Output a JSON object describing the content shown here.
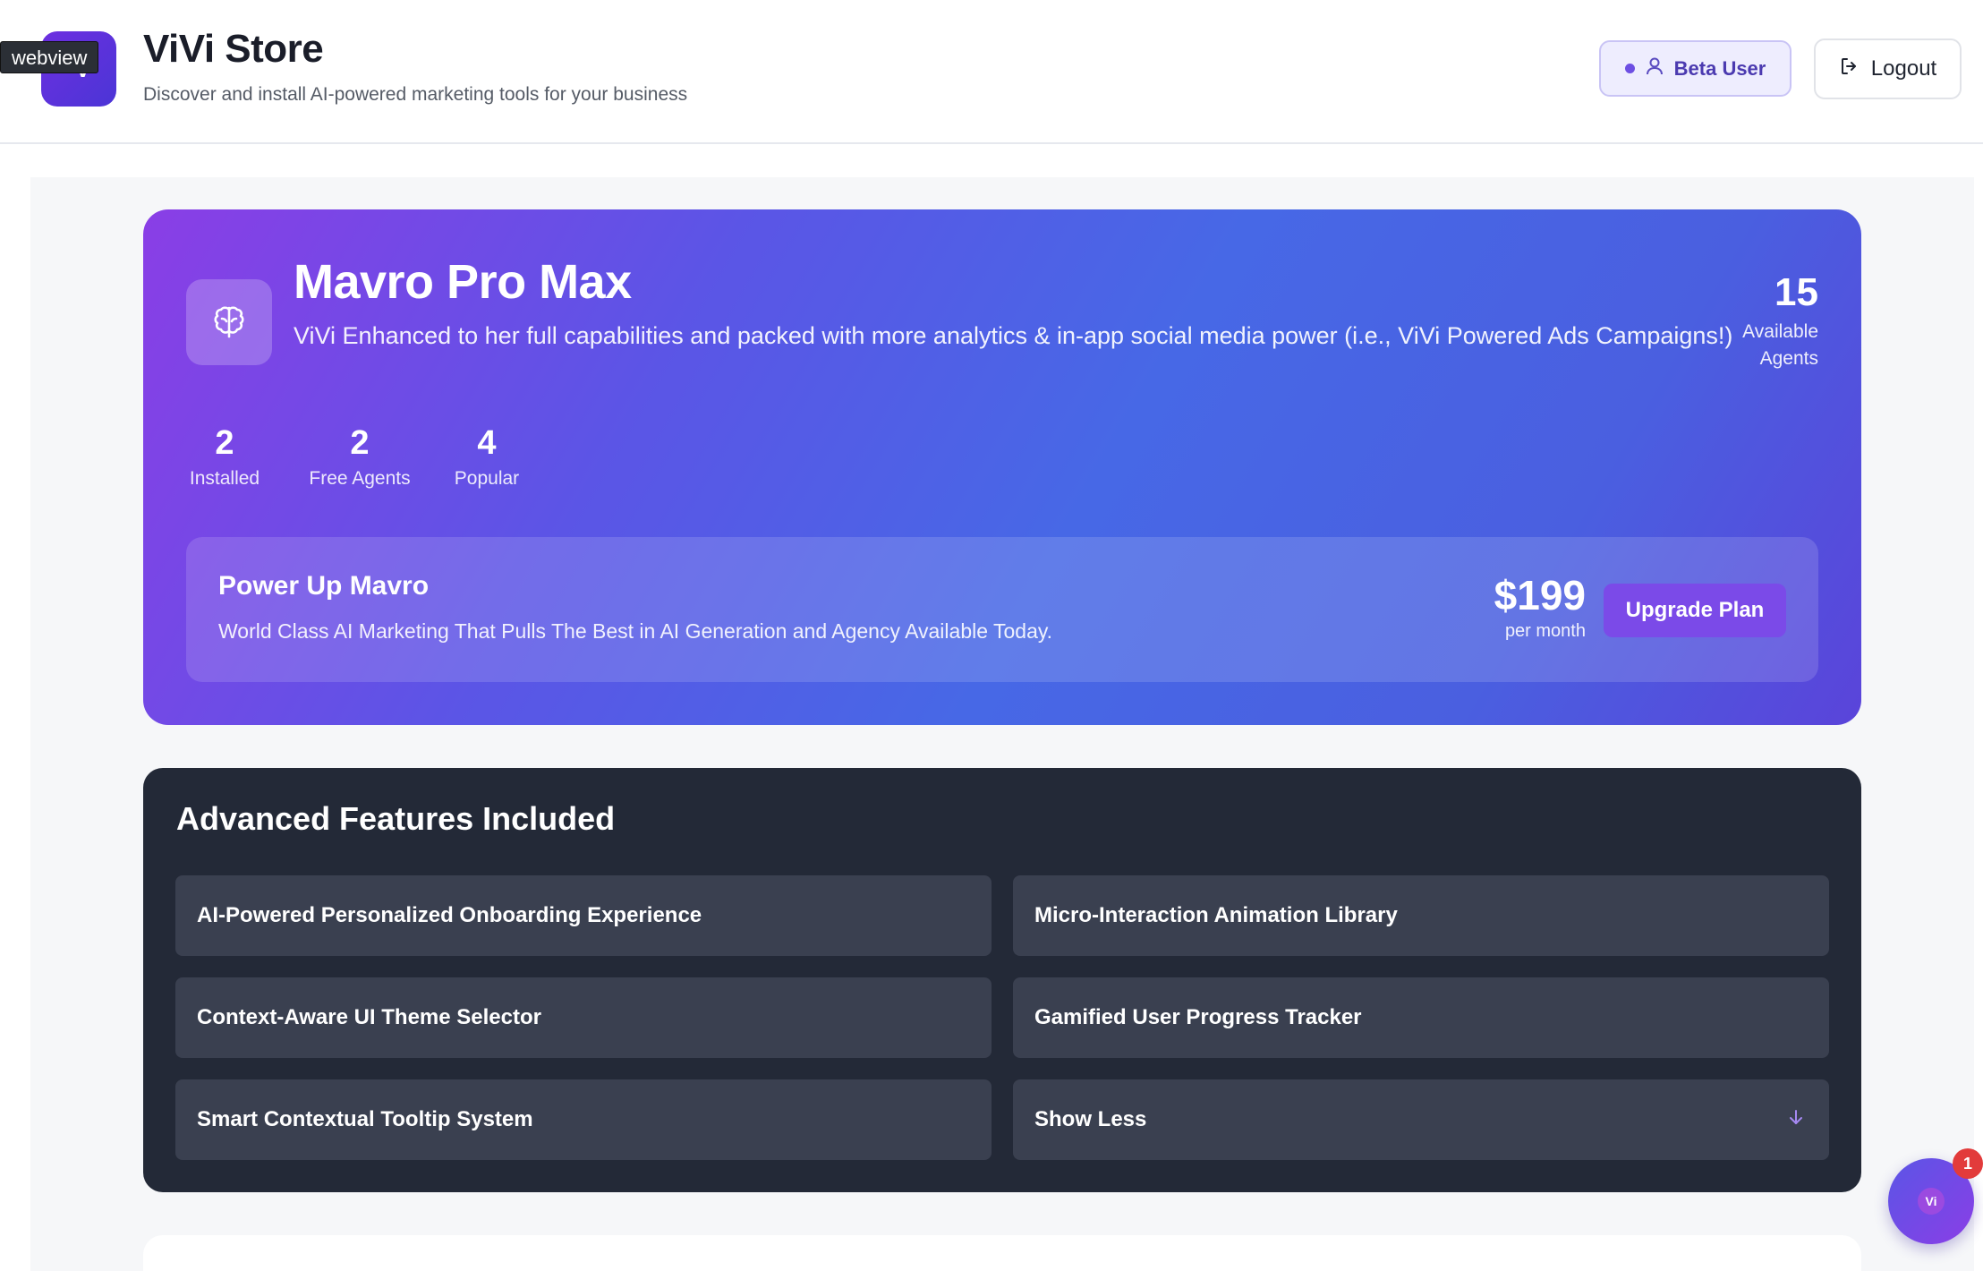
{
  "webview_tag": "webview",
  "header": {
    "logo_text": "•V",
    "title": "ViVi Store",
    "subtitle": "Discover and install AI-powered marketing tools for your business",
    "beta_label": "Beta User",
    "logout_label": "Logout"
  },
  "hero": {
    "title": "Mavro Pro Max",
    "description": "ViVi Enhanced to her full capabilities and packed with more analytics & in-app social media power (i.e., ViVi Powered Ads Campaigns!)",
    "agents_count": "15",
    "agents_label": "Available Agents",
    "stats": [
      {
        "value": "2",
        "label": "Installed"
      },
      {
        "value": "2",
        "label": "Free Agents"
      },
      {
        "value": "4",
        "label": "Popular"
      }
    ],
    "power": {
      "title": "Power Up Mavro",
      "description": "World Class AI Marketing That Pulls The Best in AI Generation and Agency Available Today.",
      "price": "$199",
      "price_unit": "per month",
      "upgrade_label": "Upgrade Plan"
    }
  },
  "features": {
    "title": "Advanced Features Included",
    "items": [
      "AI-Powered Personalized Onboarding Experience",
      "Micro-Interaction Animation Library",
      "Context-Aware UI Theme Selector",
      "Gamified User Progress Tracker",
      "Smart Contextual Tooltip System"
    ],
    "show_less_label": "Show Less"
  },
  "chat": {
    "label": "Vi",
    "badge_count": "1"
  },
  "colors": {
    "brand_purple": "#6d2fe0",
    "hero_gradient_start": "#8a3ee6",
    "hero_gradient_mid": "#4768e6",
    "features_bg": "#232937",
    "feature_item_bg": "#3a4050",
    "upgrade_button": "#7b4ae8",
    "badge_red": "#e23b3b"
  },
  "icons": {
    "hero": "brain-icon",
    "beta": "user-icon",
    "logout": "logout-icon",
    "show_less": "arrow-down-icon"
  }
}
